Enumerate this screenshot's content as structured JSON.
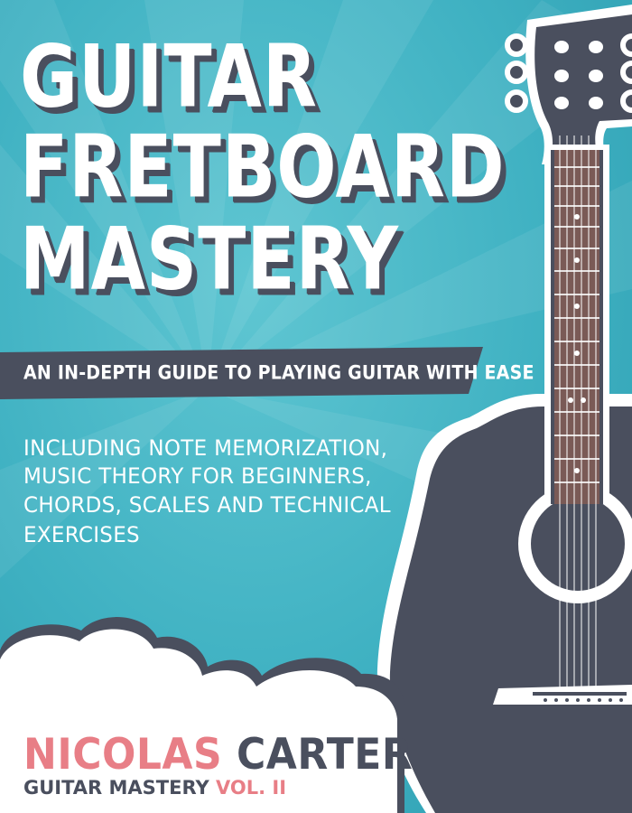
{
  "cover": {
    "title_lines": [
      "GUITAR",
      "FRETBOARD",
      "MASTERY"
    ],
    "banner": "AN IN-DEPTH GUIDE TO PLAYING GUITAR WITH EASE",
    "subtitle_lines": [
      "INCLUDING NOTE MEMORIZATION,",
      "MUSIC THEORY FOR BEGINNERS,",
      "CHORDS, SCALES AND TECHNICAL",
      "EXERCISES"
    ],
    "author": {
      "first": "NICOLAS",
      "last": "CARTER"
    },
    "series": {
      "name": "GUITAR MASTERY",
      "volume": "VOL. II"
    }
  },
  "colors": {
    "background": "#3fb1c2",
    "dark": "#4a4f5e",
    "accent_pink": "#e87e86",
    "fretboard": "#7a5a56",
    "white": "#ffffff"
  },
  "icons": [
    "acoustic-guitar-illustration",
    "cloud-shape"
  ]
}
